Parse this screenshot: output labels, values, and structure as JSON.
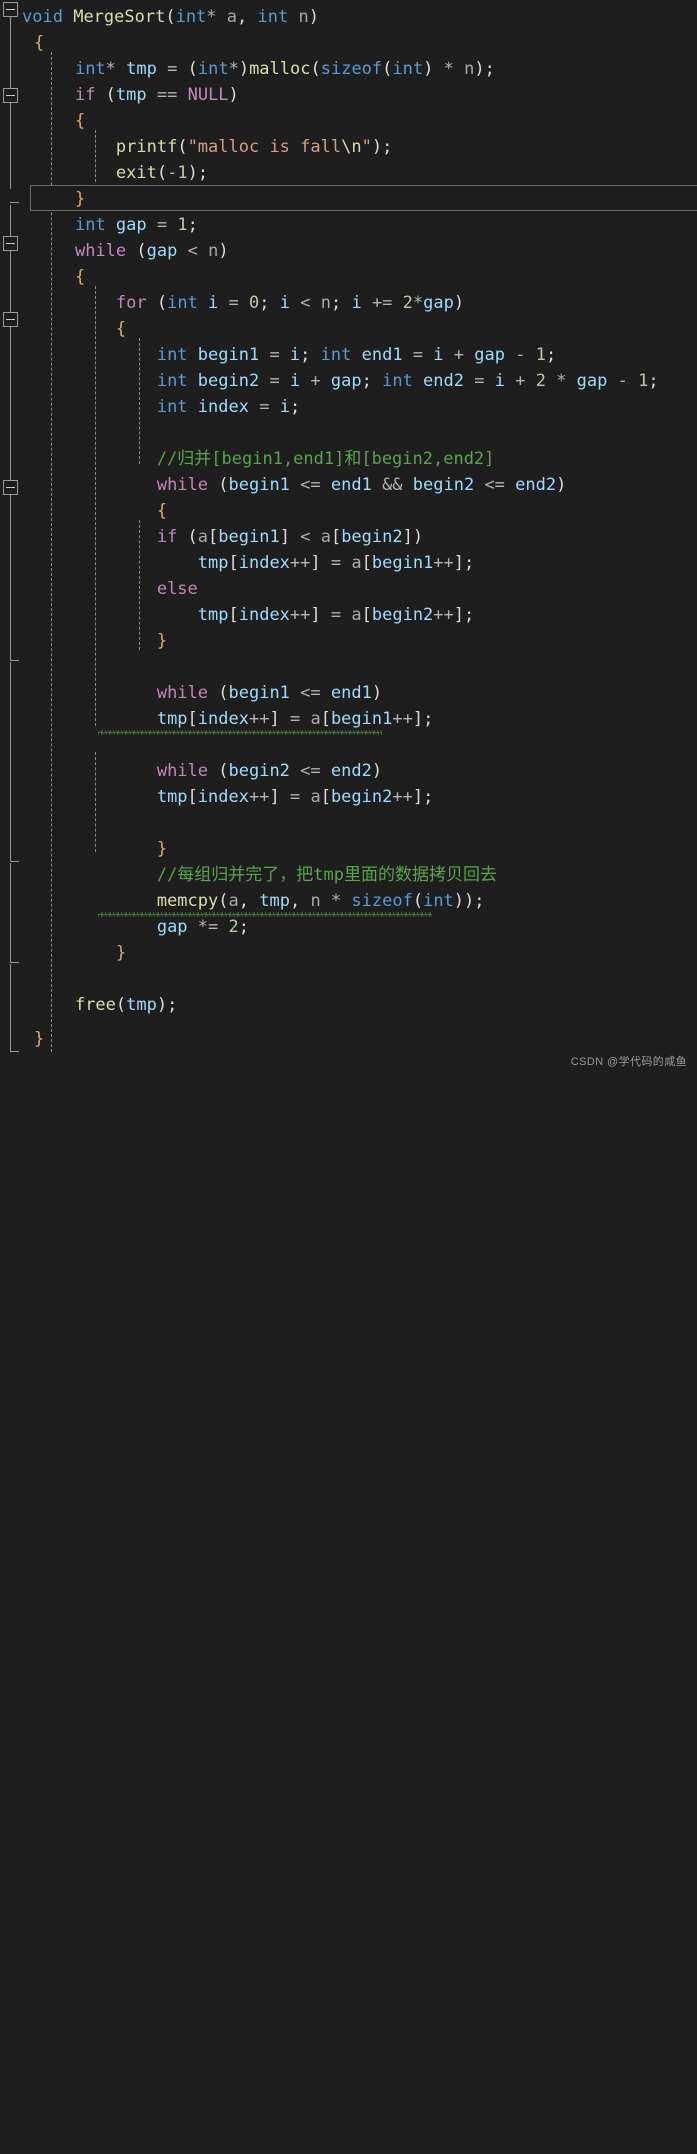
{
  "editor": {
    "theme": "vs-dark",
    "background": "#1e1e1e",
    "language": "c",
    "line_height_px": 26,
    "font_size_px": 17
  },
  "colors": {
    "background": "#1e1e1e",
    "keyword": "#c586c0",
    "type": "#569cd6",
    "function": "#dcdcaa",
    "identifier": "#9cdcfe",
    "parameter": "#a8a8a8",
    "number": "#b5cea8",
    "string": "#d69d85",
    "comment": "#57a64a",
    "punctuation": "#dcdcdc",
    "brace": "#d4b06a",
    "warning_squiggle": "#57a64a",
    "gutter_line": "#9a9a9a",
    "current_line_border": "#6a6a6a"
  },
  "code_lines": [
    {
      "n": 1,
      "text": "void MergeSort(int* a, int n)"
    },
    {
      "n": 2,
      "text": "{"
    },
    {
      "n": 3,
      "text": "    int* tmp = (int*)malloc(sizeof(int) * n);"
    },
    {
      "n": 4,
      "text": "    if (tmp == NULL)"
    },
    {
      "n": 5,
      "text": "    {"
    },
    {
      "n": 6,
      "text": "        printf(\"malloc is fall\\n\");"
    },
    {
      "n": 7,
      "text": "        exit(-1);"
    },
    {
      "n": 8,
      "text": "    }"
    },
    {
      "n": 9,
      "text": "    int gap = 1;"
    },
    {
      "n": 10,
      "text": "    while (gap < n)"
    },
    {
      "n": 11,
      "text": "    {"
    },
    {
      "n": 12,
      "text": "        for (int i = 0; i < n; i += 2*gap)"
    },
    {
      "n": 13,
      "text": "        {"
    },
    {
      "n": 14,
      "text": "            int begin1 = i; int end1 = i + gap - 1;"
    },
    {
      "n": 15,
      "text": "            int begin2 = i + gap; int end2 = i + 2 * gap - 1;"
    },
    {
      "n": 16,
      "text": "            int index = i;"
    },
    {
      "n": 17,
      "text": ""
    },
    {
      "n": 18,
      "text": "            //归并[begin1,end1]和[begin2,end2]"
    },
    {
      "n": 19,
      "text": "            while (begin1 <= end1 && begin2 <= end2)"
    },
    {
      "n": 20,
      "text": "            {"
    },
    {
      "n": 21,
      "text": "            if (a[begin1] < a[begin2])"
    },
    {
      "n": 22,
      "text": "                tmp[index++] = a[begin1++];"
    },
    {
      "n": 23,
      "text": "            else"
    },
    {
      "n": 24,
      "text": "                tmp[index++] = a[begin2++];"
    },
    {
      "n": 25,
      "text": "            }"
    },
    {
      "n": 26,
      "text": ""
    },
    {
      "n": 27,
      "text": "            while (begin1 <= end1)"
    },
    {
      "n": 28,
      "text": "            tmp[index++] = a[begin1++];"
    },
    {
      "n": 29,
      "text": ""
    },
    {
      "n": 30,
      "text": "            while (begin2 <= end2)"
    },
    {
      "n": 31,
      "text": "            tmp[index++] = a[begin2++];"
    },
    {
      "n": 32,
      "text": ""
    },
    {
      "n": 33,
      "text": "            }"
    },
    {
      "n": 34,
      "text": "            //每组归并完了，把tmp里面的数据拷贝回去"
    },
    {
      "n": 35,
      "text": "            memcpy(a, tmp, n * sizeof(int));"
    },
    {
      "n": 36,
      "text": "            gap *= 2;"
    },
    {
      "n": 37,
      "text": "        }"
    },
    {
      "n": 38,
      "text": ""
    },
    {
      "n": 39,
      "text": "    free(tmp);"
    },
    {
      "n": 40,
      "text": "}"
    }
  ],
  "comments": {
    "merge_ranges": "//归并[begin1,end1]和[begin2,end2]",
    "copy_back": "//每组归并完了，把tmp里面的数据拷贝回去"
  },
  "string_literals": {
    "malloc_fail": "\"malloc is fall\\n\""
  },
  "warnings": [
    {
      "line": 28,
      "text": "tmp[index++] = a[begin1++]"
    },
    {
      "line": 35,
      "text": "memcpy(a, tmp, n * sizeof(int))"
    }
  ],
  "fold_markers": [
    {
      "state": "expanded",
      "line": 1
    },
    {
      "state": "expanded",
      "line": 4
    },
    {
      "state": "expanded",
      "line": 10
    },
    {
      "state": "expanded",
      "line": 12
    },
    {
      "state": "expanded",
      "line": 19
    }
  ],
  "current_line": {
    "line": 8,
    "text": "    }"
  },
  "watermark": {
    "text": "CSDN @学代码的咸鱼"
  }
}
